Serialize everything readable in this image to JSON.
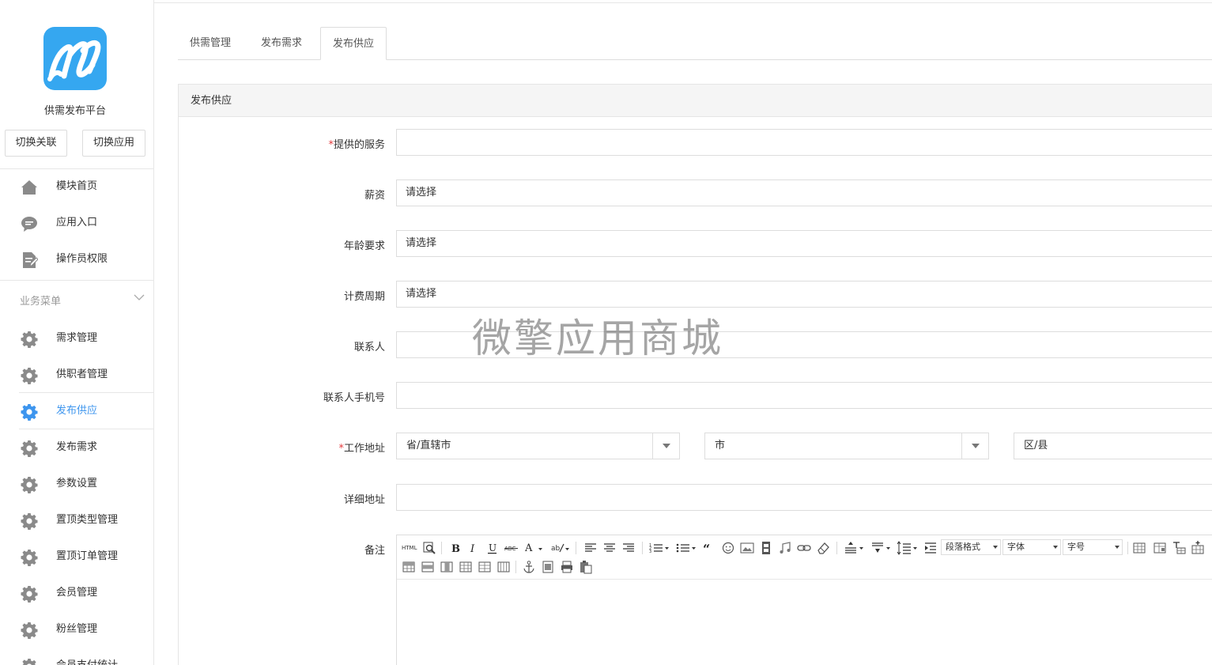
{
  "sidebar": {
    "app_title": "供需发布平台",
    "switch_relation": "切换关联",
    "switch_app": "切换应用",
    "top_items": [
      {
        "label": "模块首页",
        "icon": "home-icon"
      },
      {
        "label": "应用入口",
        "icon": "chat-icon"
      },
      {
        "label": "操作员权限",
        "icon": "document-edit-icon"
      }
    ],
    "section_label": "业务菜单",
    "menu_items": [
      {
        "label": "需求管理",
        "icon": "gear-icon"
      },
      {
        "label": "供职者管理",
        "icon": "gear-icon"
      },
      {
        "label": "发布供应",
        "icon": "gear-icon",
        "active": true
      },
      {
        "label": "发布需求",
        "icon": "gear-icon"
      },
      {
        "label": "参数设置",
        "icon": "gear-icon"
      },
      {
        "label": "置顶类型管理",
        "icon": "gear-icon"
      },
      {
        "label": "置顶订单管理",
        "icon": "gear-icon"
      },
      {
        "label": "会员管理",
        "icon": "gear-icon"
      },
      {
        "label": "粉丝管理",
        "icon": "gear-icon"
      },
      {
        "label": "会员支付统计",
        "icon": "gear-icon"
      }
    ]
  },
  "tabs": [
    "供需管理",
    "发布需求",
    "发布供应"
  ],
  "active_tab": "发布供应",
  "panel_title": "发布供应",
  "form": {
    "service_label": "提供的服务",
    "service_value": "",
    "salary_label": "薪资",
    "salary_value": "请选择",
    "age_label": "年龄要求",
    "age_value": "请选择",
    "cycle_label": "计费周期",
    "cycle_value": "请选择",
    "contact_label": "联系人",
    "contact_value": "",
    "phone_label": "联系人手机号",
    "phone_value": "",
    "address_label": "工作地址",
    "province": "省/直辖市",
    "city": "市",
    "district": "区/县",
    "detail_label": "详细地址",
    "detail_value": "",
    "remark_label": "备注",
    "required_mark": "*"
  },
  "editor": {
    "paragraph_format": "段落格式",
    "font_family": "字体",
    "font_size": "字号",
    "html_label": "HTML"
  },
  "watermark": "微擎应用商城",
  "colors": {
    "accent": "#3d95ee",
    "logo": "#35a7f0",
    "icon_gray": "#8a8a8a",
    "required": "#e4393c"
  }
}
